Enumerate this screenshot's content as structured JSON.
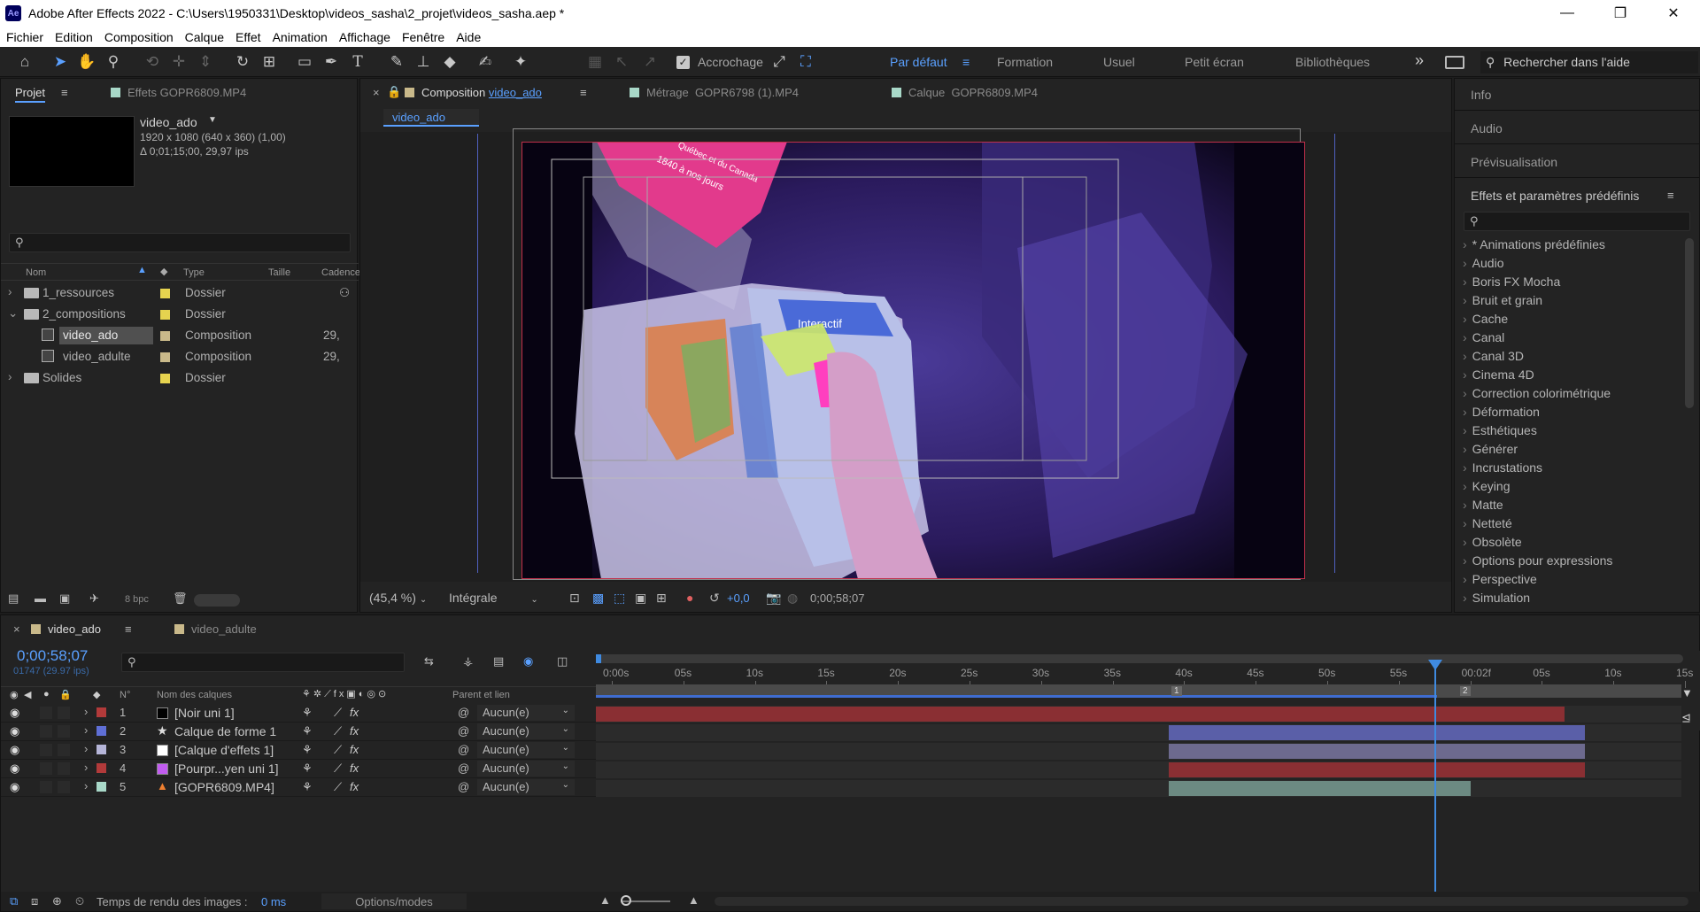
{
  "window": {
    "title": "Adobe After Effects 2022 - C:\\Users\\1950331\\Desktop\\videos_sasha\\2_projet\\videos_sasha.aep *",
    "app_icon": "Ae",
    "min": "—",
    "max": "❐",
    "close": "✕"
  },
  "menu": [
    "Fichier",
    "Edition",
    "Composition",
    "Calque",
    "Effet",
    "Animation",
    "Affichage",
    "Fenêtre",
    "Aide"
  ],
  "toolbar": {
    "snap_label": "Accrochage",
    "workspaces": [
      "Par défaut",
      "Formation",
      "Usuel",
      "Petit écran",
      "Bibliothèques"
    ],
    "more": "»",
    "search_placeholder": "Rechercher dans l'aide"
  },
  "project": {
    "tab_project": "Projet",
    "tab_effects": "Effets",
    "tab_effects_source": "GOPR6809.MP4",
    "item_name": "video_ado",
    "item_dims": "1920 x 1080  (640 x 360) (1,00)",
    "item_duration": "Δ 0;01;15;00, 29,97 ips",
    "columns": {
      "name": "Nom",
      "type": "Type",
      "size": "Taille",
      "rate": "Cadence"
    },
    "rows": [
      {
        "name": "1_ressources",
        "type": "Dossier",
        "rate": "",
        "color": "#e6d34f"
      },
      {
        "name": "2_compositions",
        "type": "Dossier",
        "rate": "",
        "color": "#e6d34f"
      },
      {
        "name": "video_ado",
        "type": "Composition",
        "rate": "29,",
        "color": "#c9b98a"
      },
      {
        "name": "video_adulte",
        "type": "Composition",
        "rate": "29,",
        "color": "#c9b98a"
      },
      {
        "name": "Solides",
        "type": "Dossier",
        "rate": "",
        "color": "#e6d34f"
      }
    ],
    "bpc": "8 bpc"
  },
  "viewer": {
    "tab_comp_prefix": "Composition",
    "tab_comp_name": "video_ado",
    "tab_footage_prefix": "Métrage",
    "tab_footage": "GOPR6798 (1).MP4",
    "tab_layer_prefix": "Calque",
    "tab_layer": "GOPR6809.MP4",
    "breadcrumb": "video_ado",
    "zoom": "(45,4 %)",
    "resolution": "Intégrale",
    "exposure": "+0,0",
    "timecode": "0;00;58;07",
    "book_title": "1840 à nos jours",
    "book_subtitle": "Québec et du Canada",
    "interactif": "Interactif"
  },
  "right": {
    "info": "Info",
    "audio": "Audio",
    "preview": "Prévisualisation",
    "effects": "Effets et paramètres prédéfinis",
    "effects_list": [
      "* Animations prédéfinies",
      "Audio",
      "Boris FX Mocha",
      "Bruit et grain",
      "Cache",
      "Canal",
      "Canal 3D",
      "Cinema 4D",
      "Correction colorimétrique",
      "Déformation",
      "Esthétiques",
      "Générer",
      "Incrustations",
      "Keying",
      "Matte",
      "Netteté",
      "Obsolète",
      "Options pour expressions",
      "Perspective",
      "Simulation"
    ]
  },
  "timeline": {
    "tab1": "video_ado",
    "tab2": "video_adulte",
    "timecode": "0;00;58;07",
    "frame_info": "01747 (29.97 ips)",
    "col_num": "N°",
    "col_name": "Nom des calques",
    "col_parent": "Parent et lien",
    "layers": [
      {
        "num": "1",
        "name": "[Noir uni 1]",
        "label": "#b23a3a",
        "swatch": "#000000",
        "parent": "Aucun(e)",
        "bar": "#8a2f33",
        "start": 0.0,
        "end": 0.892
      },
      {
        "num": "2",
        "name": "Calque de forme 1",
        "label": "#5f6fd6",
        "swatch": "star",
        "parent": "Aucun(e)",
        "bar": "#5a5fa8",
        "start": 0.528,
        "end": 0.911
      },
      {
        "num": "3",
        "name": "[Calque d'effets 1]",
        "label": "#b5b5d8",
        "swatch": "#ffffff",
        "parent": "Aucun(e)",
        "bar": "#6d6a8e",
        "start": 0.528,
        "end": 0.911
      },
      {
        "num": "4",
        "name": "[Pourpr...yen uni 1]",
        "label": "#b23a3a",
        "swatch": "#c25cf0",
        "parent": "Aucun(e)",
        "bar": "#8a2f33",
        "start": 0.528,
        "end": 0.911
      },
      {
        "num": "5",
        "name": "[GOPR6809.MP4]",
        "label": "#a8d8c8",
        "swatch": "cone",
        "parent": "Aucun(e)",
        "bar": "#6c8a82",
        "start": 0.528,
        "end": 0.806
      }
    ],
    "ruler": [
      "0:00s",
      "05s",
      "10s",
      "15s",
      "20s",
      "25s",
      "30s",
      "35s",
      "40s",
      "45s",
      "50s",
      "55s",
      "00:02f",
      "05s",
      "10s",
      "15s"
    ],
    "marker1": "1",
    "marker2": "2",
    "render_label": "Temps de rendu des images :",
    "render_value": "0 ms",
    "options": "Options/modes"
  }
}
